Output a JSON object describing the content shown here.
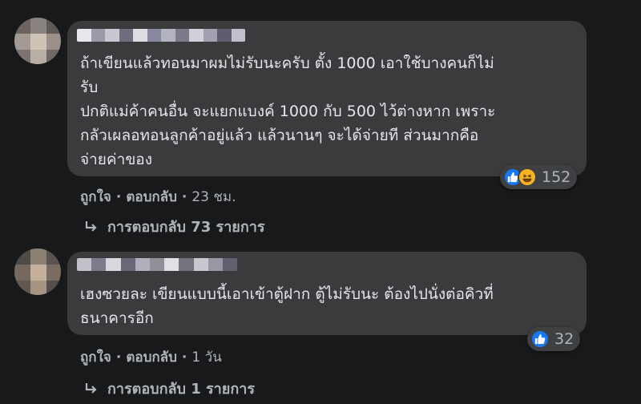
{
  "comments": [
    {
      "text": "ถ้าเขียนแล้วทอนมาผมไม่รับนะครับ ตั้ง 1000 เอาใช้บางคนก็ไม่\nรับ\nปกติแม่ค้าคนอื่น จะแยกแบงค์ 1000 กับ 500 ไว้ต่างหาก เพราะ\nกลัวเผลอทอนลูกค้าอยู่แล้ว แล้วนานๆ จะได้จ่ายที ส่วนมากคือ\nจ่ายค่าของ",
      "reaction_count": "152",
      "reactions": [
        "like-icon",
        "haha-icon"
      ],
      "like_label": "ถูกใจ",
      "reply_label": "ตอบกลับ",
      "time": "23 ชม.",
      "replies_label": "การตอบกลับ 73 รายการ"
    },
    {
      "text": "เฮงซวยละ เขียนแบบนี้เอาเข้าตู้ฝาก ตู้ไม่รับนะ ต้องไปนั่งต่อคิวที่\nธนาคารอีก",
      "reaction_count": "32",
      "reactions": [
        "like-icon"
      ],
      "like_label": "ถูกใจ",
      "reply_label": "ตอบกลับ",
      "time": "1 วัน",
      "replies_label": "การตอบกลับ 1 รายการ"
    }
  ],
  "separator": "·",
  "colors": {
    "background": "#18191a",
    "bubble": "#3a3b3c",
    "text": "#e4e6eb",
    "secondary": "#b0b3b8",
    "like_blue": "#1877f2",
    "haha_yellow": "#f7b125"
  }
}
